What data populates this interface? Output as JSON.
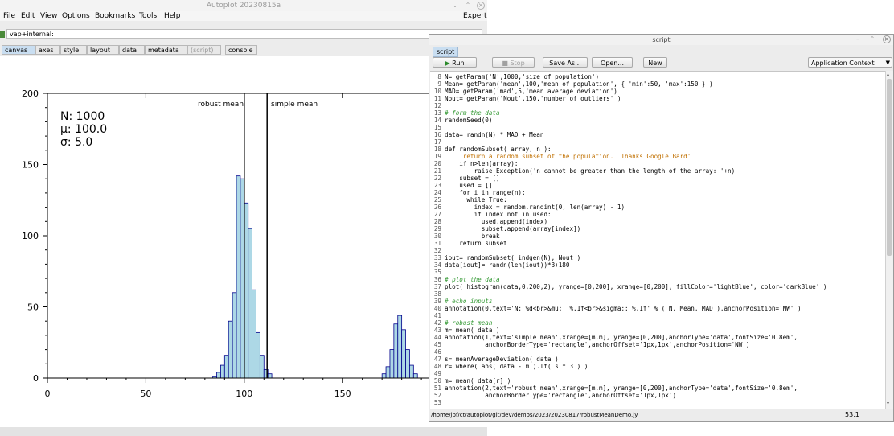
{
  "main_window": {
    "title": "Autoplot 20230815a",
    "menus": [
      "File",
      "Edit",
      "View",
      "Options",
      "Bookmarks",
      "Tools",
      "Help"
    ],
    "mode": "Expert",
    "url": "vap+internal:",
    "tabs": [
      "canvas",
      "axes",
      "style",
      "layout",
      "data",
      "metadata",
      "(script)",
      "console"
    ],
    "active_tab": "canvas"
  },
  "plot": {
    "annotation_lines": [
      "N: 1000",
      "μ: 100.0",
      "σ: 5.0"
    ],
    "robust_label": "robust mean",
    "simple_label": "simple mean",
    "robust_mean": 100.0,
    "simple_mean": 111.6
  },
  "chart_data": {
    "type": "bar",
    "xlim": [
      0,
      200
    ],
    "ylim": [
      0,
      200
    ],
    "xticks": [
      "0",
      "50",
      "100",
      "150"
    ],
    "yticks": [
      "0",
      "50",
      "100",
      "150",
      "200"
    ],
    "bin_width": 2,
    "bins": [
      [
        84,
        1
      ],
      [
        86,
        4
      ],
      [
        88,
        9
      ],
      [
        90,
        16
      ],
      [
        92,
        40
      ],
      [
        94,
        60
      ],
      [
        96,
        142
      ],
      [
        98,
        140
      ],
      [
        100,
        123
      ],
      [
        102,
        105
      ],
      [
        104,
        62
      ],
      [
        106,
        32
      ],
      [
        108,
        16
      ],
      [
        110,
        6
      ],
      [
        112,
        3
      ],
      [
        170,
        3
      ],
      [
        172,
        8
      ],
      [
        174,
        20
      ],
      [
        176,
        38
      ],
      [
        178,
        44
      ],
      [
        180,
        34
      ],
      [
        182,
        20
      ],
      [
        184,
        9
      ],
      [
        186,
        3
      ]
    ],
    "fill_color": "#add8e6",
    "edge_color": "#00008b",
    "grid": false
  },
  "script_window": {
    "title": "script",
    "tab_label": "script",
    "buttons": {
      "run": "Run",
      "stop": "Stop",
      "save_as": "Save As...",
      "open": "Open...",
      "new": "New"
    },
    "context": "Application Context",
    "status_path": "/home/jbf/ct/autoplot/git/dev/demos/2023/20230817/robustMeanDemo.jy",
    "cursor_position": "53,1",
    "lines": [
      {
        "n": "8",
        "t": "N= getParam('N',1000,'size of population')"
      },
      {
        "n": "9",
        "t": "Mean= getParam('mean',100,'mean of population', { 'min':50, 'max':150 } )"
      },
      {
        "n": "10",
        "t": "MAD= getParam('mad',5,'mean average deviation')"
      },
      {
        "n": "11",
        "t": "Nout= getParam('Nout',150,'number of outliers' )"
      },
      {
        "n": "12",
        "t": ""
      },
      {
        "n": "13",
        "t": "# form the data",
        "c": "cm"
      },
      {
        "n": "14",
        "t": "randomSeed(0)"
      },
      {
        "n": "15",
        "t": ""
      },
      {
        "n": "16",
        "t": "data= randn(N) * MAD + Mean"
      },
      {
        "n": "17",
        "t": ""
      },
      {
        "n": "18",
        "t": "def randomSubset( array, n ):"
      },
      {
        "n": "19",
        "t": "    'return a random subset of the population.  Thanks Google Bard'",
        "c": "st"
      },
      {
        "n": "20",
        "t": "    if n>len(array):"
      },
      {
        "n": "21",
        "t": "        raise Exception('n cannot be greater than the length of the array: '+n)"
      },
      {
        "n": "22",
        "t": "    subset = []"
      },
      {
        "n": "23",
        "t": "    used = []"
      },
      {
        "n": "24",
        "t": "    for i in range(n):"
      },
      {
        "n": "25",
        "t": "      while True:"
      },
      {
        "n": "26",
        "t": "        index = random.randint(0, len(array) - 1)"
      },
      {
        "n": "27",
        "t": "        if index not in used:"
      },
      {
        "n": "28",
        "t": "          used.append(index)"
      },
      {
        "n": "29",
        "t": "          subset.append(array[index])"
      },
      {
        "n": "30",
        "t": "          break"
      },
      {
        "n": "31",
        "t": "    return subset"
      },
      {
        "n": "32",
        "t": ""
      },
      {
        "n": "33",
        "t": "iout= randomSubset( indgen(N), Nout )"
      },
      {
        "n": "34",
        "t": "data[iout]= randn(len(iout))*3+180"
      },
      {
        "n": "35",
        "t": ""
      },
      {
        "n": "36",
        "t": "# plot the data",
        "c": "cm"
      },
      {
        "n": "37",
        "t": "plot( histogram(data,0,200,2), yrange=[0,200], xrange=[0,200], fillColor='lightBlue', color='darkBlue' )"
      },
      {
        "n": "38",
        "t": ""
      },
      {
        "n": "39",
        "t": "# echo inputs",
        "c": "cm"
      },
      {
        "n": "40",
        "t": "annotation(0,text='N: %d<br>&mu;: %.1f<br>&sigma;: %.1f' % ( N, Mean, MAD ),anchorPosition='NW' )"
      },
      {
        "n": "41",
        "t": ""
      },
      {
        "n": "42",
        "t": "# robust mean",
        "c": "cm"
      },
      {
        "n": "43",
        "t": "m= mean( data )"
      },
      {
        "n": "44",
        "t": "annotation(1,text='simple mean',xrange=[m,m], yrange=[0,200],anchorType='data',fontSize='0.8em',"
      },
      {
        "n": "45",
        "t": "           anchorBorderType='rectangle',anchorOffset='1px,1px',anchorPosition='NW')"
      },
      {
        "n": "46",
        "t": ""
      },
      {
        "n": "47",
        "t": "s= meanAverageDeviation( data )"
      },
      {
        "n": "48",
        "t": "r= where( abs( data - m ).lt( s * 3 ) )"
      },
      {
        "n": "49",
        "t": ""
      },
      {
        "n": "50",
        "t": "m= mean( data[r] )"
      },
      {
        "n": "51",
        "t": "annotation(2,text='robust mean',xrange=[m,m], yrange=[0,200],anchorType='data',fontSize='0.8em',"
      },
      {
        "n": "52",
        "t": "           anchorBorderType='rectangle',anchorOffset='1px,1px')"
      },
      {
        "n": "53",
        "t": ""
      }
    ]
  }
}
